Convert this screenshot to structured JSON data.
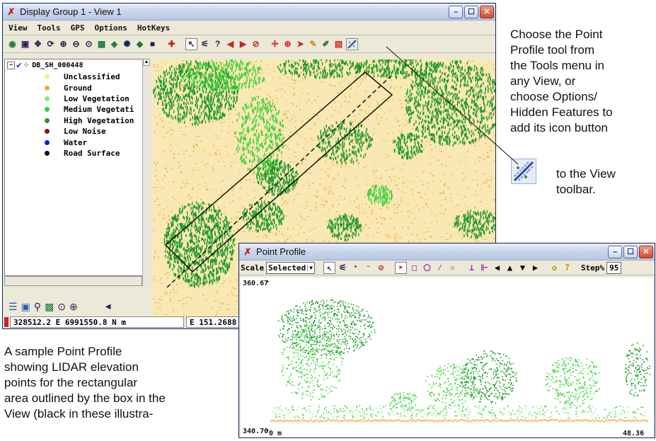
{
  "main_window": {
    "title": "Display Group 1 - View 1",
    "minimize": "–",
    "maximize": "☐",
    "close": "✕",
    "menu": [
      "View",
      "Tools",
      "GPS",
      "Options",
      "HotKeys"
    ]
  },
  "layer": {
    "name": "DB_SH_000448",
    "legend": [
      {
        "label": "Unclassified",
        "color": "#f6f27a"
      },
      {
        "label": "Ground",
        "color": "#f5a63a"
      },
      {
        "label": "Low Vegetation",
        "color": "#8ce87a"
      },
      {
        "label": "Medium Vegetati",
        "color": "#3ad23a"
      },
      {
        "label": "High Vegetation",
        "color": "#1f9a2a"
      },
      {
        "label": "Low Noise",
        "color": "#8a1414"
      },
      {
        "label": "Water",
        "color": "#1414e6"
      },
      {
        "label": "Road Surface",
        "color": "#111111"
      }
    ]
  },
  "status": {
    "coords": "328512.2 E  6991550.8 N m",
    "east": "E 151.2688"
  },
  "profile_window": {
    "title": "Point Profile",
    "scale_label": "Scale",
    "scale_value": "Selected",
    "step_label": "Step%",
    "step_value": "95",
    "y_top": "360.67",
    "y_bottom": "340.70",
    "x_left": "0 m",
    "x_right": "48.36"
  },
  "captions": {
    "right_lines": [
      "Choose the Point",
      "Profile tool from",
      "the Tools menu in",
      "any View, or",
      "choose Options/",
      "Hidden Features to",
      "add its icon button"
    ],
    "right_indent_lines": [
      "to the View",
      "toolbar."
    ],
    "left_lines": [
      "A sample Point Profile",
      "showing LIDAR elevation",
      "points for the rectangular",
      "area outlined by the box in the",
      "View (black in these illustra-"
    ]
  },
  "colors": {
    "ground": "#f5a63a",
    "vegetation_dark": "#1f9a2a",
    "vegetation_light": "#3ad23a",
    "view_bg": "#f9e8b4"
  },
  "icons": {
    "view_toolbar": [
      "zoom-extent-icon",
      "zoom-box-icon",
      "pan-icon",
      "refresh-icon",
      "zoom-in-icon",
      "zoom-out-icon",
      "zoom-fit-icon",
      "layers-icon",
      "point-profile-icon"
    ],
    "profile_toolbar": [
      "select-icon",
      "rectangle-icon",
      "polygon-icon",
      "line-icon",
      "delete-icon",
      "left-arrow-icon",
      "up-arrow-icon",
      "down-arrow-icon",
      "right-arrow-icon",
      "palette-icon",
      "help-icon"
    ]
  }
}
